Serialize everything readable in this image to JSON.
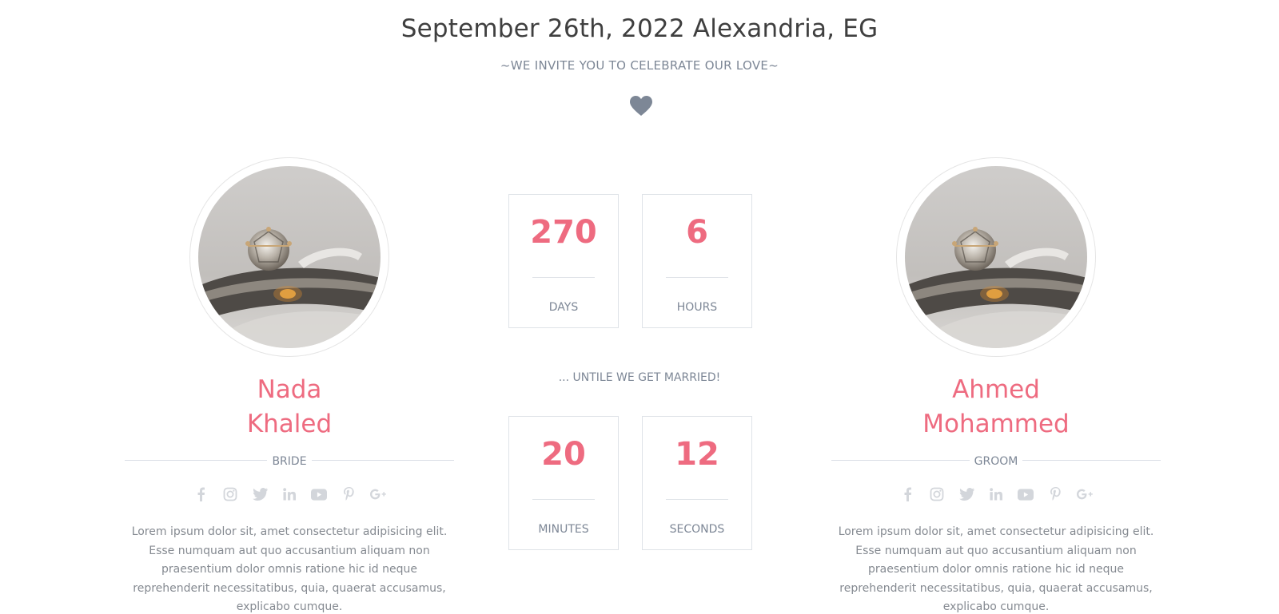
{
  "header": {
    "date_location": "September 26th, 2022 Alexandria, EG",
    "tagline": "~WE INVITE YOU TO CELEBRATE OUR LOVE~",
    "icon": "heart-icon"
  },
  "bride": {
    "name_first": "Nada",
    "name_last": "Khaled",
    "role": "BRIDE",
    "bio": "Lorem ipsum dolor sit, amet consectetur adipisicing elit. Esse numquam aut quo accusantium aliquam non praesentium dolor omnis ratione hic id neque reprehenderit necessitatibus, quia, quaerat accusamus, explicabo cumque."
  },
  "groom": {
    "name_first": "Ahmed",
    "name_last": "Mohammed",
    "role": "GROOM",
    "bio": "Lorem ipsum dolor sit, amet consectetur adipisicing elit. Esse numquam aut quo accusantium aliquam non praesentium dolor omnis ratione hic id neque reprehenderit necessitatibus, quia, quaerat accusamus, explicabo cumque."
  },
  "socials": [
    "facebook-icon",
    "instagram-icon",
    "twitter-icon",
    "linkedin-icon",
    "youtube-icon",
    "pinterest-icon",
    "google-plus-icon"
  ],
  "countdown": {
    "days": {
      "value": "270",
      "label": "DAYS"
    },
    "hours": {
      "value": "6",
      "label": "HOURS"
    },
    "minutes": {
      "value": "20",
      "label": "MINUTES"
    },
    "seconds": {
      "value": "12",
      "label": "SECONDS"
    },
    "until_text": "... UNTILE WE GET MARRIED!"
  },
  "colors": {
    "accent": "#ee6b80",
    "muted": "#7d8796",
    "heading": "#3f3f3f",
    "icon": "#d3d6db"
  }
}
